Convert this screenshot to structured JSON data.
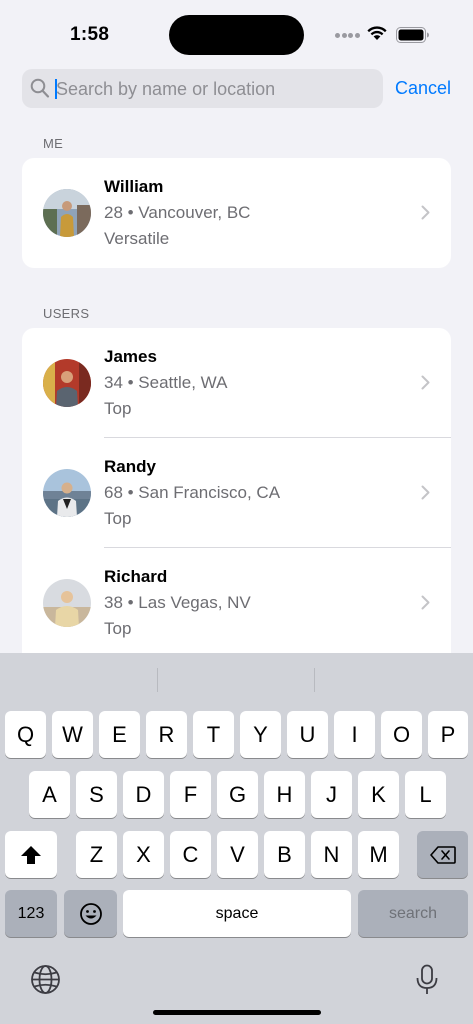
{
  "status": {
    "time": "1:58"
  },
  "search": {
    "placeholder": "Search by name or location",
    "value": "",
    "cancel_label": "Cancel"
  },
  "me_section": {
    "header": "ME",
    "user": {
      "name": "William",
      "details": "28 • Vancouver, BC",
      "role": "Versatile"
    }
  },
  "users_section": {
    "header": "USERS",
    "users": [
      {
        "name": "James",
        "details": "34 • Seattle, WA",
        "role": "Top"
      },
      {
        "name": "Randy",
        "details": "68 • San Francisco, CA",
        "role": "Top"
      },
      {
        "name": "Richard",
        "details": "38 • Las Vegas, NV",
        "role": "Top"
      }
    ]
  },
  "keyboard": {
    "row1": [
      "Q",
      "W",
      "E",
      "R",
      "T",
      "Y",
      "U",
      "I",
      "O",
      "P"
    ],
    "row2": [
      "A",
      "S",
      "D",
      "F",
      "G",
      "H",
      "J",
      "K",
      "L"
    ],
    "row3": [
      "Z",
      "X",
      "C",
      "V",
      "B",
      "N",
      "M"
    ],
    "numbers_label": "123",
    "space_label": "space",
    "search_label": "search"
  },
  "colors": {
    "accent": "#007aff",
    "background": "#f2f2f7",
    "keyboard": "#d1d3d9"
  }
}
